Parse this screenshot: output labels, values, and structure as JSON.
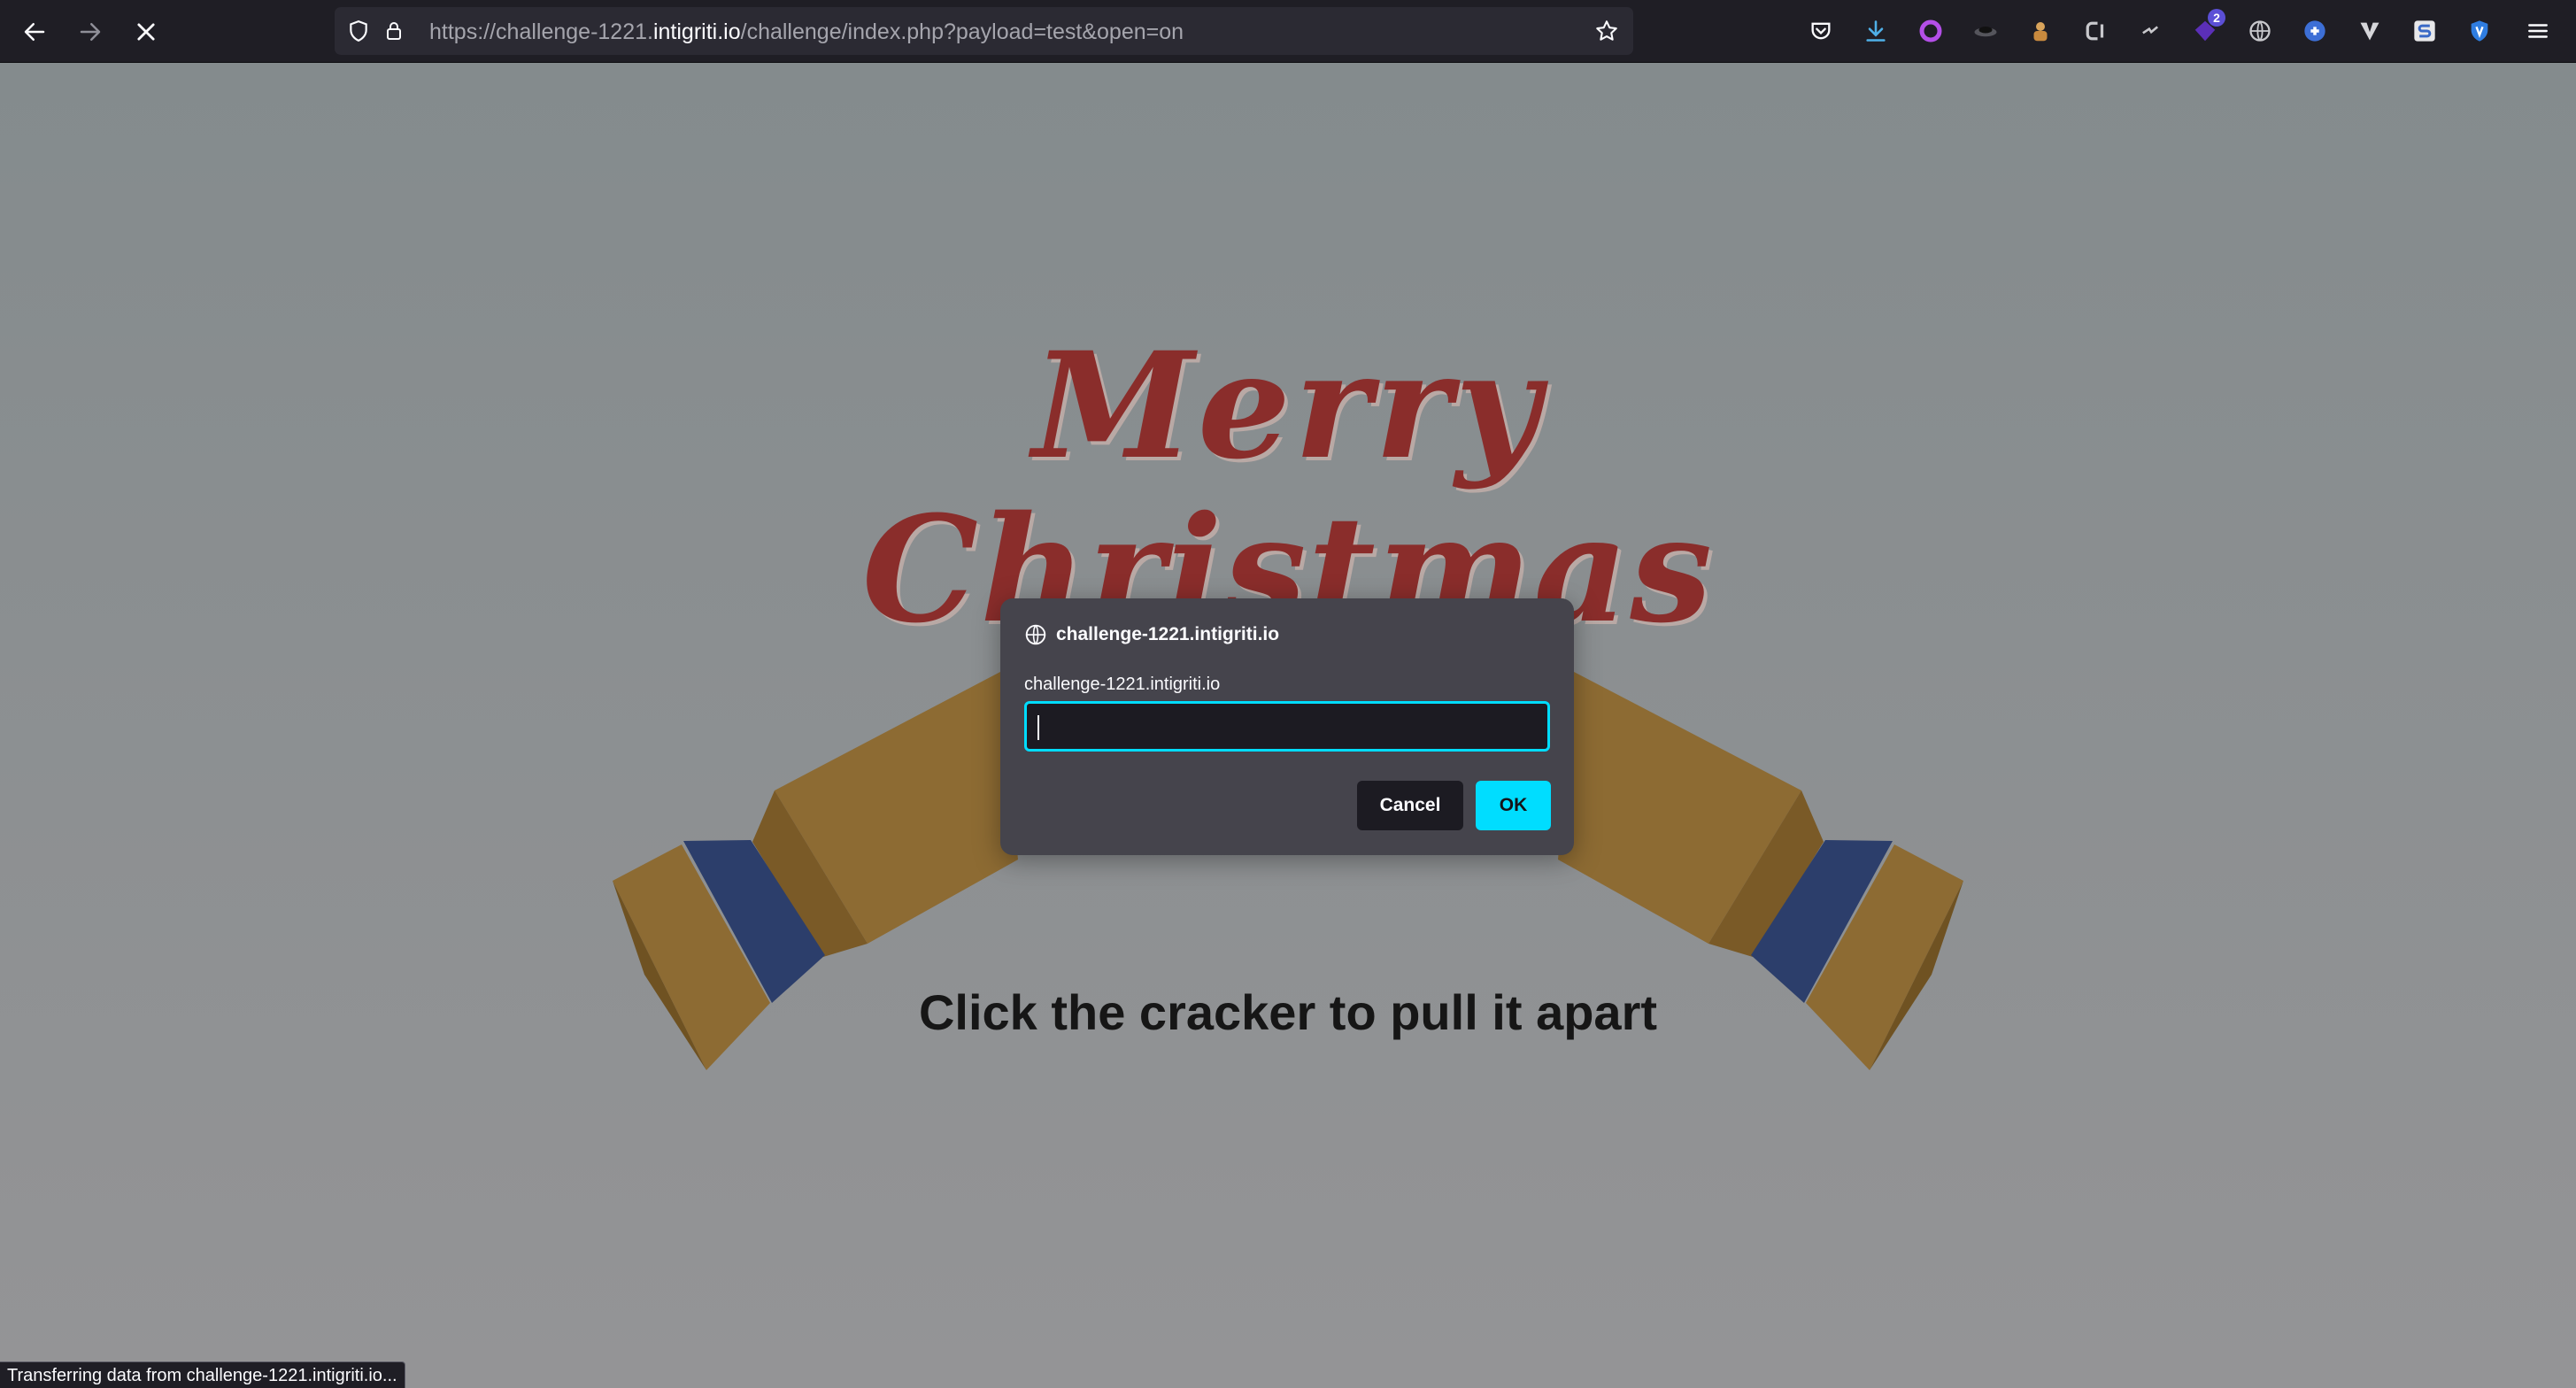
{
  "browser": {
    "url_scheme": "https://",
    "url_host_prefix": "challenge-1221.",
    "url_host_domain": "intigriti.io",
    "url_path": "/challenge/index.php?payload=test&open=on",
    "extension_badge_count": "2",
    "status_text": "Transferring data from challenge-1221.intigriti.io...",
    "icons": [
      "back-arrow-icon",
      "forward-arrow-icon",
      "stop-loading-icon",
      "shield-icon",
      "lock-icon",
      "bookmark-star-icon",
      "pocket-icon",
      "download-icon",
      "extension-circle-icon",
      "extension-mask-icon",
      "extension-cookie-icon",
      "extension-c-icon",
      "extension-arrow-icon",
      "extension-badge-icon",
      "extension-globe-icon",
      "extension-puzzle-icon",
      "extension-v-icon",
      "extension-s-icon",
      "extension-shield-icon",
      "menu-icon"
    ]
  },
  "page": {
    "title_line1": "Merry",
    "title_line2": "Christmas",
    "caption": "Click the cracker to pull it apart",
    "colors": {
      "title": "#8a2d2b",
      "cracker_body": "#8d6b33",
      "cracker_band": "#2c3e6b",
      "background": "#8e9396"
    }
  },
  "dialog": {
    "origin": "challenge-1221.intigriti.io",
    "message": "challenge-1221.intigriti.io",
    "input_value": "",
    "cancel_label": "Cancel",
    "ok_label": "OK",
    "accent_color": "#00ddff"
  }
}
